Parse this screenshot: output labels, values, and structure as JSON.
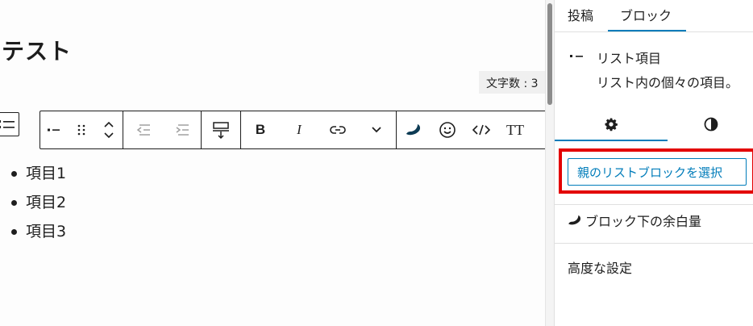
{
  "editor": {
    "post_title": "テスト",
    "char_count": "文字数 : 3",
    "list_items": [
      "項目1",
      "項目2",
      "項目3"
    ]
  },
  "toolbar": {
    "icons": [
      "list-item-icon",
      "drag-handle-icon",
      "move-up-icon",
      "move-down-icon",
      "outdent-icon",
      "indent-icon",
      "margin-bottom-icon",
      "bold-icon",
      "italic-icon",
      "link-icon",
      "more-chevron-icon",
      "swell-icon",
      "emoji-icon",
      "code-icon",
      "text-size-icon"
    ],
    "bold_label": "B",
    "italic_label": "I",
    "text_size_label": "TT"
  },
  "sidebar": {
    "tabs": [
      {
        "label": "投稿",
        "active": false
      },
      {
        "label": "ブロック",
        "active": true
      }
    ],
    "block_name": "リスト項目",
    "block_description": "リスト内の個々の項目。",
    "sub_tabs": [
      {
        "icon": "gear-icon",
        "active": true
      },
      {
        "icon": "contrast-icon",
        "active": false
      }
    ],
    "select_parent_label": "親のリストブロックを選択",
    "panel_margin_label": "ブロック下の余白量",
    "panel_advanced_label": "高度な設定"
  },
  "colors": {
    "accent": "#007cba",
    "highlight": "#e30000",
    "text": "#1e1e1e"
  }
}
